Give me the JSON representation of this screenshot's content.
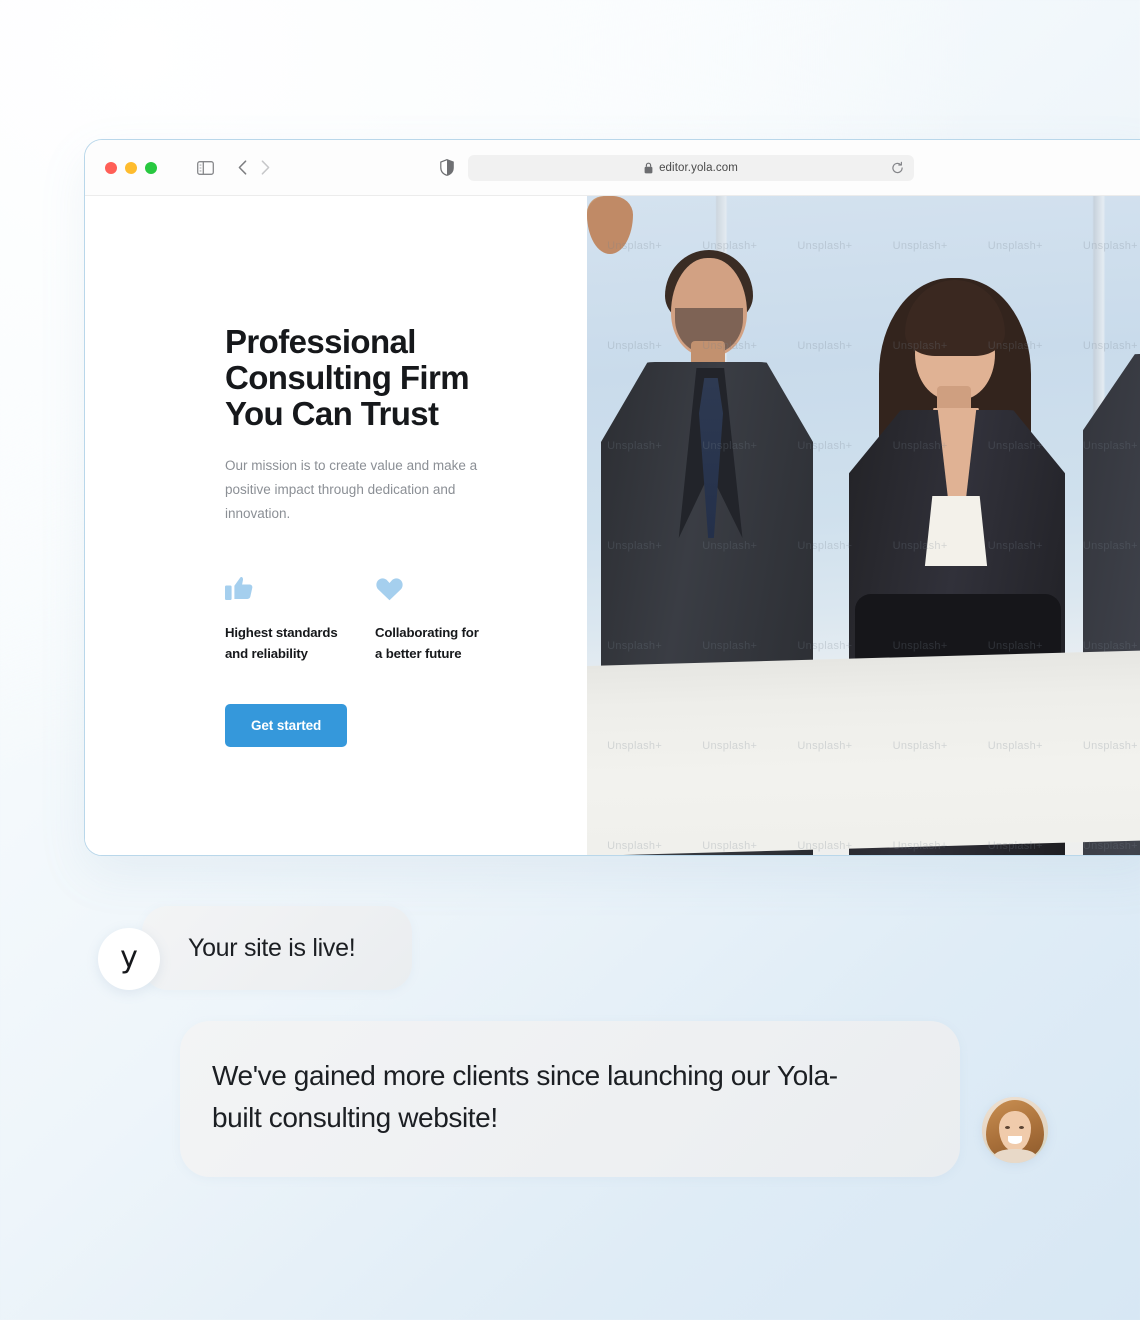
{
  "browser": {
    "traffic_lights": [
      "close",
      "minimize",
      "maximize"
    ],
    "sidebar_toggle_icon": "sidebar-toggle-icon",
    "back_icon": "chevron-left-icon",
    "forward_icon": "chevron-right-icon",
    "shield_icon": "privacy-shield-icon",
    "lock_icon": "lock-icon",
    "url": "editor.yola.com",
    "reload_icon": "reload-icon"
  },
  "hero": {
    "title": "Professional\nConsulting Firm\nYou Can Trust",
    "subtitle": "Our mission is to create value and make a\npositive impact through dedication and\ninnovation.",
    "features": [
      {
        "icon": "thumbs-up-icon",
        "label": "Highest standards\nand reliability"
      },
      {
        "icon": "heart-icon",
        "label": "Collaborating for\na better future"
      }
    ],
    "cta_label": "Get started",
    "image_alt": "Three business professionals standing in an office",
    "image_watermark": "Unsplash+"
  },
  "chat": {
    "messages": [
      {
        "avatar": "yola-logo-avatar",
        "avatar_glyph": "y",
        "text": "Your site is live!"
      },
      {
        "avatar": "customer-photo-avatar",
        "text": "We've gained more clients since launching our Yola-\nbuilt consulting website!"
      }
    ]
  },
  "colors": {
    "accent": "#3598db",
    "icon_blue": "#a5cfee",
    "heading": "#16181b",
    "muted_text": "#8b8f95",
    "bubble_bg": "#eef0f2",
    "window_border": "#b9d7ea"
  }
}
